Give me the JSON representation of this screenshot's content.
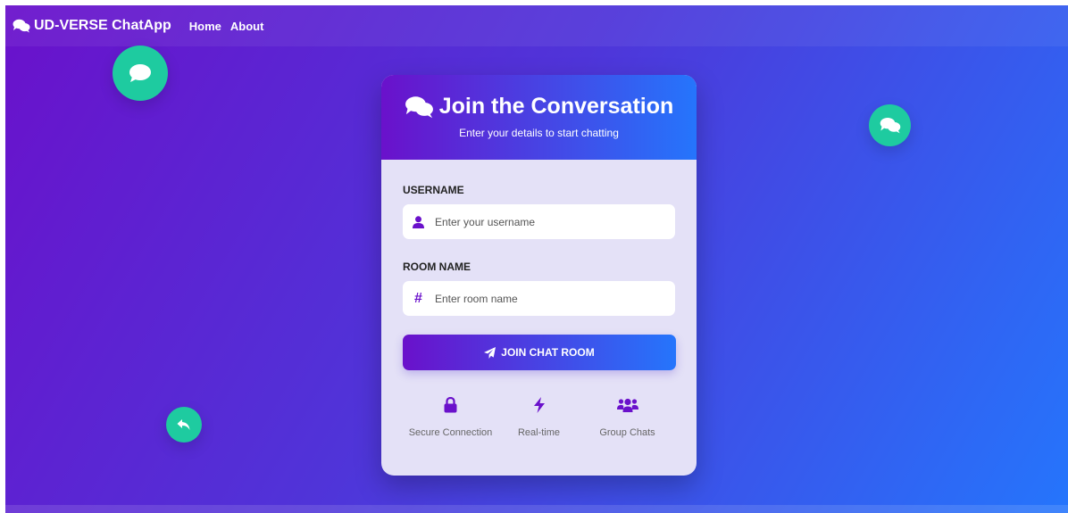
{
  "navbar": {
    "brand": "UD-VERSE ChatApp",
    "links": [
      "Home",
      "About"
    ]
  },
  "card": {
    "title": "Join the Conversation",
    "subtitle": "Enter your details to start chatting",
    "username": {
      "label": "USERNAME",
      "placeholder": "Enter your username",
      "value": ""
    },
    "room": {
      "label": "ROOM NAME",
      "placeholder": "Enter room name",
      "value": ""
    },
    "join_button": "JOIN CHAT ROOM",
    "features": [
      {
        "label": "Secure Connection",
        "icon": "lock-icon"
      },
      {
        "label": "Real-time",
        "icon": "bolt-icon"
      },
      {
        "label": "Group Chats",
        "icon": "users-icon"
      }
    ]
  },
  "decor": {
    "bubbles": [
      "comment-icon",
      "comments-icon",
      "reply-icon"
    ]
  },
  "colors": {
    "gradient_start": "#6a11cb",
    "gradient_end": "#2575fc",
    "accent_green": "#1ecba0",
    "card_bg": "#e4e1f7"
  }
}
